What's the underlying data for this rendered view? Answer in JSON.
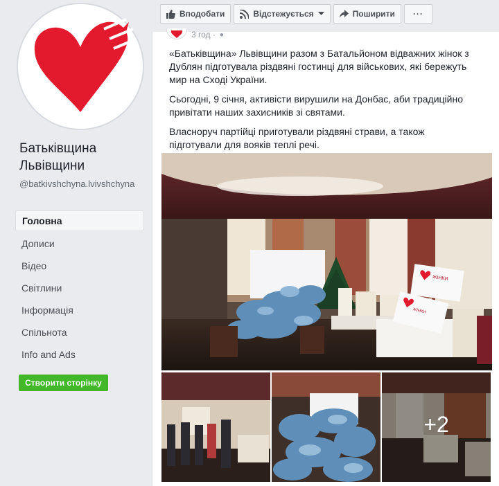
{
  "page": {
    "name": "Батьківщина Львівщини",
    "handle": "@batkivshchyna.lvivshchyna"
  },
  "nav": {
    "items": [
      "Головна",
      "Дописи",
      "Відео",
      "Світлини",
      "Інформація",
      "Спільнота",
      "Info and Ads"
    ],
    "active_index": 0,
    "create_page_label": "Створити сторінку"
  },
  "actions": {
    "like_label": "Вподобати",
    "follow_label": "Відстежується",
    "share_label": "Поширити",
    "more_label": "···"
  },
  "post": {
    "time": "3 год ·",
    "paragraphs": [
      "«Батьківщина» Львівщини разом з Батальйоном відважних жінок з Дублян підготувала різдвяні гостинці для військових, які бережуть мир на Сході України.",
      "Сьогодні, 9 січня, активісти вирушили на Донбас, аби традиційно привітати наших захисників зі святами.",
      "Власноруч партійці приготували різдвяні страви, а також підготували для вояків теплі речі."
    ],
    "banner_text": "ЖІНКИ БАТЬКІВЩИНИ",
    "more_photos_label": "+2"
  },
  "colors": {
    "brand_red": "#e3192d",
    "create_green": "#42b72a",
    "bg": "#e9ebee"
  }
}
